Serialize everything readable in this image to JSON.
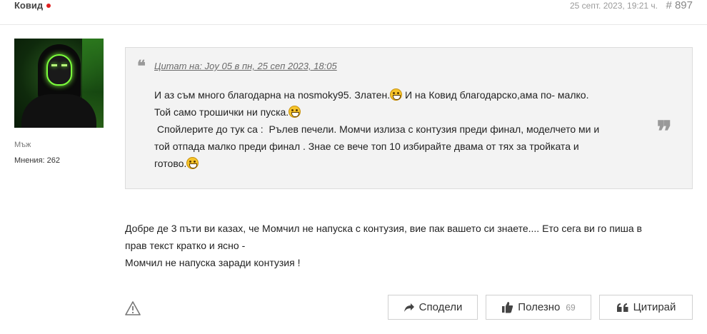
{
  "post": {
    "author": "Ковид",
    "date": "25 септ. 2023, 19:21 ч.",
    "number": "# 897"
  },
  "user": {
    "gender": "Мъж",
    "opinions": "Мнения: 262"
  },
  "quote": {
    "cite": "Цитат на: Joy 05 в пн, 25 сеп 2023, 18:05",
    "line1_a": "И аз съм много благодарна на nosmoky95. Златен.",
    "line1_b": " И на Ковид благодарско,ама по- малко.",
    "line2": "Той само трошички ни пуска.",
    "line3": " Спойлерите до тук са :  Рълев печели. Момчи излиза с контузия преди финал, моделчето ми и",
    "line4": "той отпада малко преди финал . Знае се вече топ 10 избирайте двама от тях за тройката и",
    "line5": "готово."
  },
  "body": {
    "line1": "Добре де 3 пъти ви казах, че Момчил не напуска с контузия, вие пак вашето си знаете.... Ето сега ви го пиша в",
    "line2": "прав текст кратко и ясно -",
    "line3": "Момчил не напуска заради контузия !"
  },
  "actions": {
    "share": "Сподели",
    "useful": "Полезно",
    "useful_count": "69",
    "quote": "Цитирай"
  },
  "icons": {
    "online": "online-dot-icon",
    "report": "warning-triangle-icon",
    "share": "share-arrow-icon",
    "useful": "thumbs-up-icon",
    "quote": "quote-marks-icon",
    "emoji": "grinning-face-icon"
  }
}
